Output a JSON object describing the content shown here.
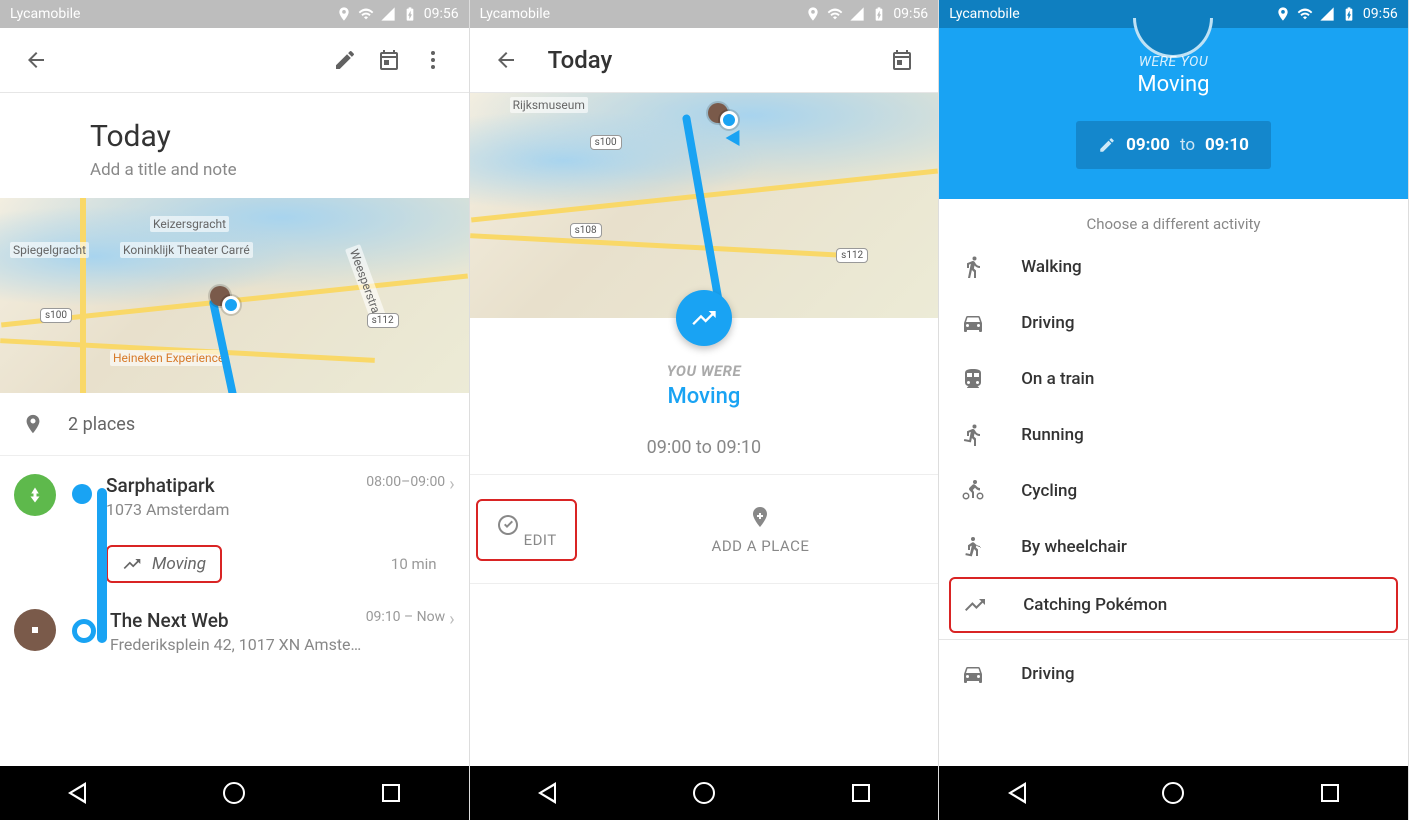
{
  "status": {
    "carrier": "Lycamobile",
    "time": "09:56"
  },
  "screen1": {
    "day_title": "Today",
    "subtitle": "Add a title and note",
    "places_count": "2 places",
    "map_labels": {
      "theater": "Koninklijk Theater Carré",
      "spiegel": "Spiegelgracht",
      "heineken": "Heineken Experience",
      "keizers": "Keizersgracht",
      "s100": "s100",
      "s112": "s112",
      "weesper": "Weesperstraat"
    },
    "stops": [
      {
        "name": "Sarphatipark",
        "sub": "1073 Amsterdam",
        "time": "08:00–09:00"
      },
      {
        "name": "The Next Web",
        "sub": "Frederiksplein 42, 1017 XN Amsterd…",
        "time": "09:10 – Now"
      }
    ],
    "moving_label": "Moving",
    "moving_duration": "10 min"
  },
  "screen2": {
    "title": "Today",
    "map_labels": {
      "rijks": "Rijksmuseum",
      "s100": "s100",
      "s108": "s108",
      "s112": "s112"
    },
    "were_label": "YOU WERE",
    "activity": "Moving",
    "time_range": "09:00 to 09:10",
    "edit_label": "EDIT",
    "add_place_label": "ADD A PLACE"
  },
  "screen3": {
    "were_label": "WERE YOU",
    "activity": "Moving",
    "time_from": "09:00",
    "time_to_word": "to",
    "time_to": "09:10",
    "choose_label": "Choose a different activity",
    "activities": [
      "Walking",
      "Driving",
      "On a train",
      "Running",
      "Cycling",
      "By wheelchair",
      "Catching Pokémon"
    ],
    "extra_activity": "Driving"
  }
}
